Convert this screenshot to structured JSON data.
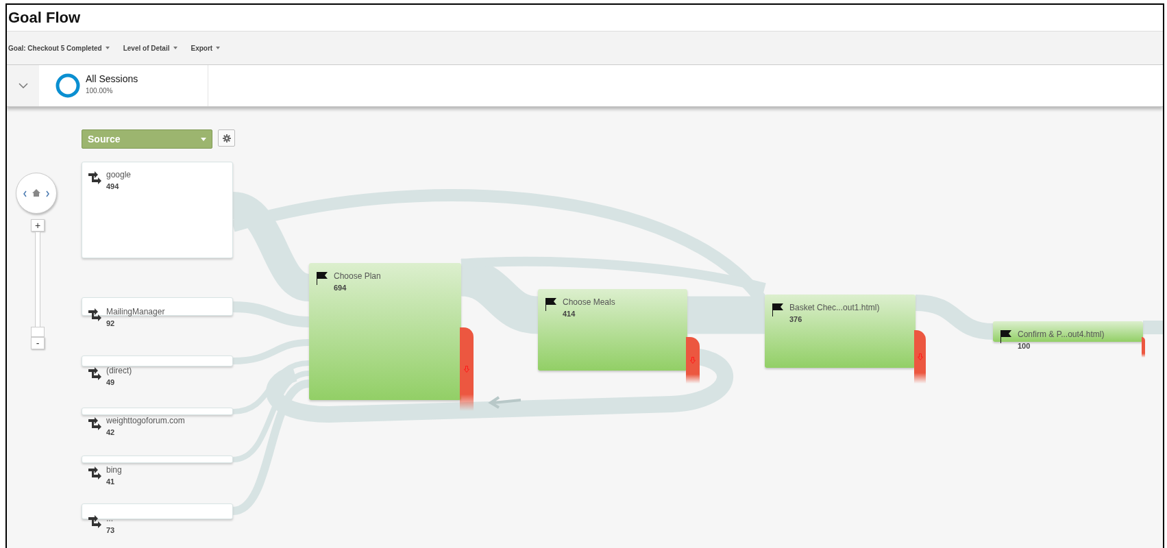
{
  "title": "Goal Flow",
  "toolbar": [
    {
      "label": "Goal: Checkout 5 Completed"
    },
    {
      "label": "Level of Detail"
    },
    {
      "label": "Export"
    }
  ],
  "segment": {
    "name": "All Sessions",
    "share": "100.00%"
  },
  "dimension": "Source",
  "zoom": {
    "plus": "+",
    "minus": "-",
    "level": 0
  },
  "sources": [
    {
      "name": "google",
      "count": "494"
    },
    {
      "name": "MailingManager",
      "count": "92"
    },
    {
      "name": "(direct)",
      "count": "49"
    },
    {
      "name": "weighttogoforum.com",
      "count": "42"
    },
    {
      "name": "bing",
      "count": "41"
    },
    {
      "name": "...",
      "count": "73"
    }
  ],
  "steps": [
    {
      "name": "Choose Plan",
      "count": "694"
    },
    {
      "name": "Choose Meals",
      "count": "414"
    },
    {
      "name": "Basket Chec...out1.html)",
      "count": "376"
    },
    {
      "name": "Confirm & P...out4.html)",
      "count": "100"
    }
  ]
}
